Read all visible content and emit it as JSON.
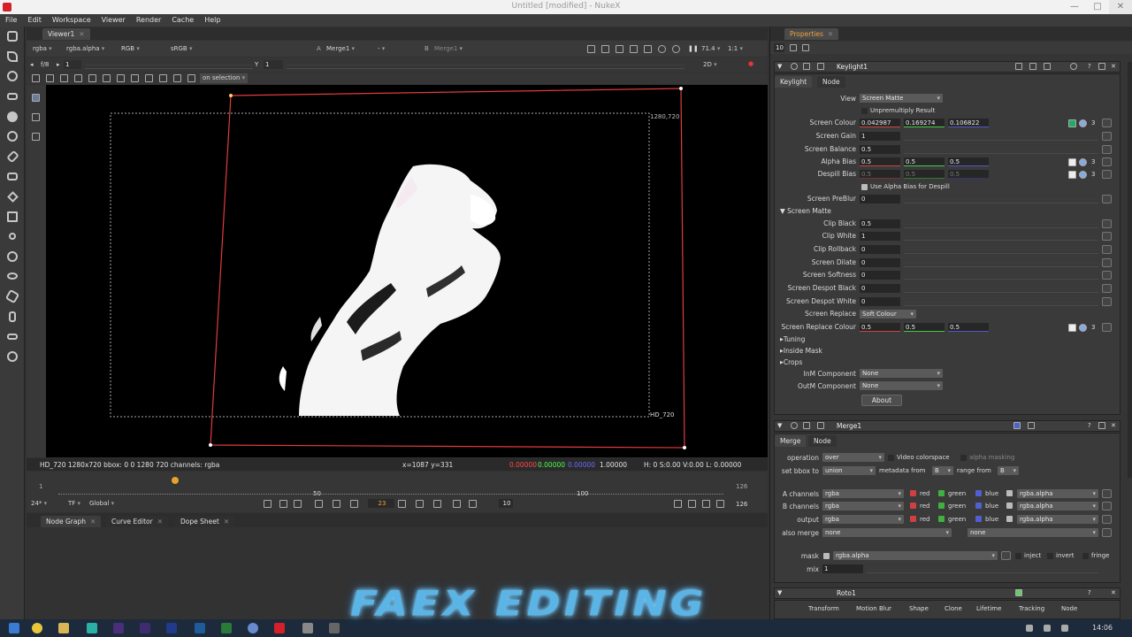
{
  "app": {
    "title": "Untitled [modified] - NukeX"
  },
  "menu": [
    "File",
    "Edit",
    "Workspace",
    "Viewer",
    "Render",
    "Cache",
    "Help"
  ],
  "viewer_tab": {
    "label": "Viewer1"
  },
  "viewer_top": {
    "channels": "rgba",
    "alpha": "rgba.alpha",
    "rgb": "RGB",
    "lut": "sRGB",
    "a_input": "Merge1",
    "dash": "-",
    "b_label": "B",
    "b_input": "Merge1",
    "zoom": "71.4",
    "ratio": "1:1"
  },
  "viewer_row2": {
    "fstop": "f/8",
    "frame_step": "1",
    "y_label": "Y",
    "y_value": "1",
    "mode": "2D"
  },
  "viewer_row3": {
    "roi": "on selection"
  },
  "canvas": {
    "fmt_tr": "1280,720",
    "fmt_br": "HD_720"
  },
  "status": {
    "info": "HD_720 1280x720  bbox: 0 0 1280 720 channels: rgba",
    "coords": "x=1087 y=331",
    "r": "0.00000",
    "g": "0.00000",
    "b": "0.00000",
    "a": "1.00000",
    "hsv": "H: 0 S:0.00 V:0.00  L: 0.00000"
  },
  "timeline": {
    "start": "1",
    "end": "126",
    "t50": "50",
    "t100": "100",
    "fps": "24*",
    "tf": "TF",
    "global": "Global",
    "current": "23",
    "step": "10",
    "out": "126"
  },
  "bottom_tabs": [
    "Node Graph",
    "Curve Editor",
    "Dope Sheet"
  ],
  "properties": {
    "tab": "Properties",
    "max_panels": "10"
  },
  "keylight": {
    "name": "Keylight1",
    "tabs": [
      "Keylight",
      "Node"
    ],
    "view_label": "View",
    "view_value": "Screen Matte",
    "unpremult": "Unpremultiply Result",
    "rows": [
      {
        "label": "Screen Colour",
        "v": [
          "0.042987",
          "0.169274",
          "0.106822"
        ]
      },
      {
        "label": "Screen Gain",
        "v": [
          "1"
        ]
      },
      {
        "label": "Screen Balance",
        "v": [
          "0.5"
        ]
      },
      {
        "label": "Alpha Bias",
        "v": [
          "0.5",
          "0.5",
          "0.5"
        ]
      },
      {
        "label": "Despill Bias",
        "v": [
          "0.5",
          "0.5",
          "0.5"
        ]
      }
    ],
    "use_alpha_bias": "Use Alpha Bias for Despill",
    "prebluer_label": "Screen PreBlur",
    "prebluer_value": "0",
    "screen_matte": "Screen Matte",
    "matte_rows": [
      {
        "label": "Clip Black",
        "v": "0.5"
      },
      {
        "label": "Clip White",
        "v": "1"
      },
      {
        "label": "Clip Rollback",
        "v": "0"
      },
      {
        "label": "Screen Dilate",
        "v": "0"
      },
      {
        "label": "Screen Softness",
        "v": "0"
      },
      {
        "label": "Screen Despot Black",
        "v": "0"
      },
      {
        "label": "Screen Despot White",
        "v": "0"
      }
    ],
    "replace_label": "Screen Replace",
    "replace_value": "Soft Colour",
    "replace_colour_label": "Screen Replace Colour",
    "replace_colour": [
      "0.5",
      "0.5",
      "0.5"
    ],
    "sections": [
      "Tuning",
      "Inside Mask",
      "Crops"
    ],
    "inm_label": "InM Component",
    "inm_value": "None",
    "outm_label": "OutM Component",
    "outm_value": "None",
    "about": "About"
  },
  "merge": {
    "name": "Merge1",
    "tabs": [
      "Merge",
      "Node"
    ],
    "operation_label": "operation",
    "operation": "over",
    "video_colorspace": "Video colorspace",
    "alpha_masking": "alpha masking",
    "bbox_label": "set bbox to",
    "bbox": "union",
    "metadata_label": "metadata from",
    "metadata": "B",
    "range_label": "range from",
    "range": "B",
    "channels": [
      {
        "label": "A channels",
        "value": "rgba",
        "alpha": "rgba.alpha"
      },
      {
        "label": "B channels",
        "value": "rgba",
        "alpha": "rgba.alpha"
      },
      {
        "label": "output",
        "value": "rgba",
        "alpha": "rgba.alpha"
      }
    ],
    "red": "red",
    "green": "green",
    "blue": "blue",
    "also_merge_label": "also merge",
    "also_merge": "none",
    "also_merge2": "none",
    "mask_label": "mask",
    "mask": "rgba.alpha",
    "inject": "inject",
    "invert": "invert",
    "fringe": "fringe",
    "mix_label": "mix",
    "mix": "1"
  },
  "roto": {
    "name": "Roto1",
    "tabs": [
      "Transform",
      "Motion Blur",
      "Shape",
      "Clone",
      "Lifetime",
      "Tracking",
      "Node"
    ]
  },
  "watermark": "FAEX EDITING",
  "taskbar": {
    "clock": "14:06"
  }
}
